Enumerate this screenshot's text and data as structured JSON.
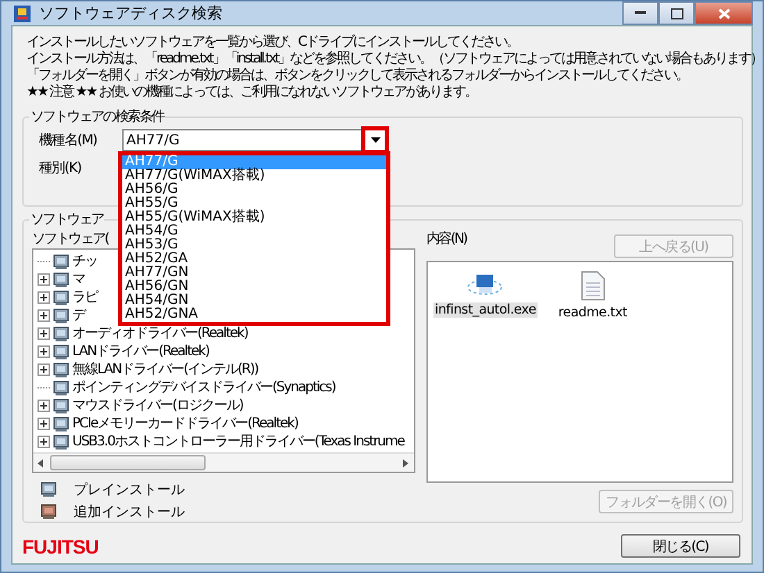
{
  "window": {
    "title": "ソフトウェアディスク検索"
  },
  "instructions": [
    "インストールしたいソフトウェアを一覧から選び、Cドライブにインストールしてください。",
    "インストール方法は、「readme.txt」「install.txt」などを参照してください。（ソフトウェアによっては用意されていない場合もあります）",
    "「フォルダーを開く」ボタンが有効の場合は、ボタンをクリックして表示されるフォルダーからインストールしてください。",
    "★★ 注意 ★★ お使いの機種によっては、ご利用になれないソフトウェアがあります。"
  ],
  "search_group": {
    "title": "ソフトウェアの検索条件",
    "model": {
      "label": "機種名(M)",
      "value": "AH77/G"
    },
    "type": {
      "label": "種別(K)"
    },
    "dropdown": {
      "open": true,
      "items": [
        {
          "label": "AH77/G",
          "selected": true
        },
        {
          "label": "AH77/G(WiMAX搭載)",
          "selected": false
        },
        {
          "label": "AH56/G",
          "selected": false
        },
        {
          "label": "AH55/G",
          "selected": false
        },
        {
          "label": "AH55/G(WiMAX搭載)",
          "selected": false
        },
        {
          "label": "AH54/G",
          "selected": false
        },
        {
          "label": "AH53/G",
          "selected": false
        },
        {
          "label": "AH52/GA",
          "selected": false
        },
        {
          "label": "AH77/GN",
          "selected": false
        },
        {
          "label": "AH56/GN",
          "selected": false
        },
        {
          "label": "AH54/GN",
          "selected": false
        },
        {
          "label": "AH52/GNA",
          "selected": false
        }
      ]
    }
  },
  "software_group": {
    "title": "ソフトウェア",
    "list_label": "ソフトウェア(",
    "tree": [
      {
        "label": "チッ",
        "expandable": false
      },
      {
        "label": "マ",
        "expandable": true
      },
      {
        "label": "ラピ",
        "expandable": true
      },
      {
        "label": "デ",
        "expandable": true
      },
      {
        "label": "オーディオドライバー(Realtek)",
        "expandable": true
      },
      {
        "label": "LANドライバー(Realtek)",
        "expandable": true
      },
      {
        "label": "無線LANドライバー(インテル(R))",
        "expandable": true
      },
      {
        "label": "ポインティングデバイスドライバー(Synaptics)",
        "expandable": false
      },
      {
        "label": "マウスドライバー(ロジクール)",
        "expandable": true
      },
      {
        "label": "PCIeメモリーカードドライバー(Realtek)",
        "expandable": true
      },
      {
        "label": "USB3.0ホストコントローラー用ドライバー(Texas Instrume",
        "expandable": true
      }
    ],
    "legend": [
      {
        "label": "プレインストール",
        "kind": "preinstall"
      },
      {
        "label": "追加インストール",
        "kind": "added"
      }
    ],
    "contents_label": "内容(N)",
    "back_button": {
      "label": "上へ戻る(U)",
      "disabled": true
    },
    "files": [
      {
        "name": "infinst_autol.exe",
        "kind": "exe",
        "selected": true
      },
      {
        "name": "readme.txt",
        "kind": "txt",
        "selected": false
      }
    ],
    "open_folder_button": {
      "label": "フォルダーを開く(O)",
      "disabled": true
    }
  },
  "logo": "FUJITSU",
  "close_button": {
    "label": "閉じる(C)"
  }
}
